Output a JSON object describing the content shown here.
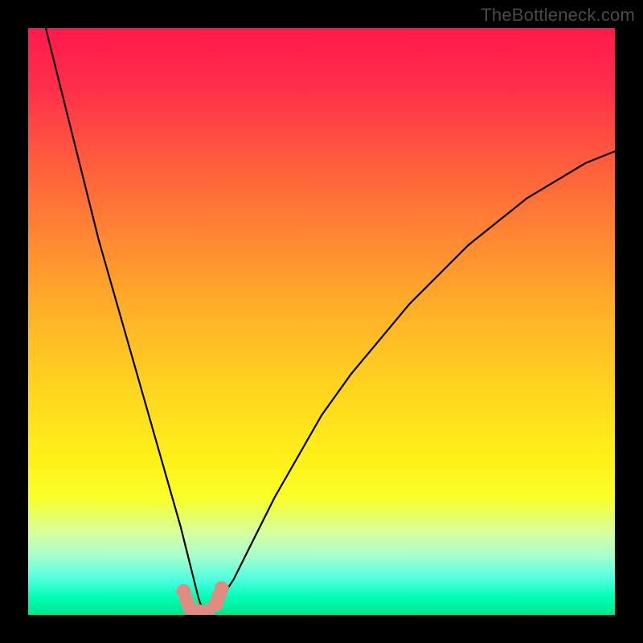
{
  "watermark": "TheBottleneck.com",
  "colors": {
    "frame": "#000000",
    "gradient_top": "#ff1a4d",
    "gradient_bottom": "#00e68c",
    "curve_stroke": "#000000",
    "marker_fill": "#e28b82"
  },
  "chart_data": {
    "type": "line",
    "title": "",
    "xlabel": "",
    "ylabel": "",
    "xlim": [
      0,
      100
    ],
    "ylim": [
      0,
      100
    ],
    "grid": false,
    "note": "No axes, ticks, or numeric labels are rendered; values are estimated from pixel positions. V-shaped curve with minimum near x≈30, y≈0.",
    "series": [
      {
        "name": "curve",
        "x": [
          3,
          4,
          6,
          8,
          10,
          12,
          14,
          16,
          18,
          20,
          22,
          24,
          26,
          27,
          28,
          29,
          30,
          31,
          32,
          33,
          35,
          38,
          42,
          46,
          50,
          55,
          60,
          65,
          70,
          75,
          80,
          85,
          90,
          95,
          100
        ],
        "y": [
          100,
          96,
          88,
          80,
          72,
          64,
          57,
          50,
          43,
          36,
          29,
          22,
          15,
          11,
          7,
          3,
          0,
          1,
          2,
          3,
          6,
          12,
          20,
          27,
          34,
          41,
          47,
          53,
          58,
          63,
          67,
          71,
          74,
          77,
          79
        ]
      }
    ],
    "markers": [
      {
        "x": 26.5,
        "y": 4.0
      },
      {
        "x": 27.0,
        "y": 2.5
      },
      {
        "x": 27.5,
        "y": 1.2
      },
      {
        "x": 29.0,
        "y": 0.6
      },
      {
        "x": 30.5,
        "y": 0.6
      },
      {
        "x": 32.0,
        "y": 1.8
      },
      {
        "x": 32.5,
        "y": 3.2
      },
      {
        "x": 33.0,
        "y": 4.5
      }
    ]
  }
}
